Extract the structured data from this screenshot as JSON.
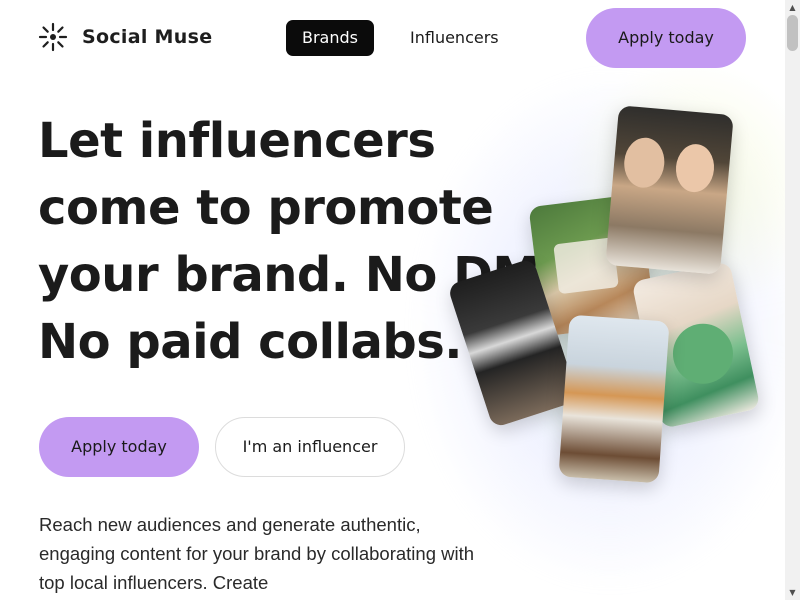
{
  "header": {
    "brand_name": "Social Muse",
    "logo_icon": "sun-burst-icon",
    "nav": [
      {
        "label": "Brands",
        "active": true
      },
      {
        "label": "Influencers",
        "active": false
      }
    ],
    "cta_label": "Apply today"
  },
  "hero": {
    "headline_lines": [
      "Let influencers",
      "come to promote",
      "your brand. No DMs.",
      "No paid collabs."
    ],
    "primary_cta": "Apply today",
    "secondary_cta": "I'm an influencer",
    "description": "Reach new audiences and generate authentic, engaging content for your brand by collaborating with top local influencers. Create"
  },
  "theme": {
    "accent": "#c39af2",
    "dark": "#0b0b0b",
    "text": "#1b1b1b"
  }
}
